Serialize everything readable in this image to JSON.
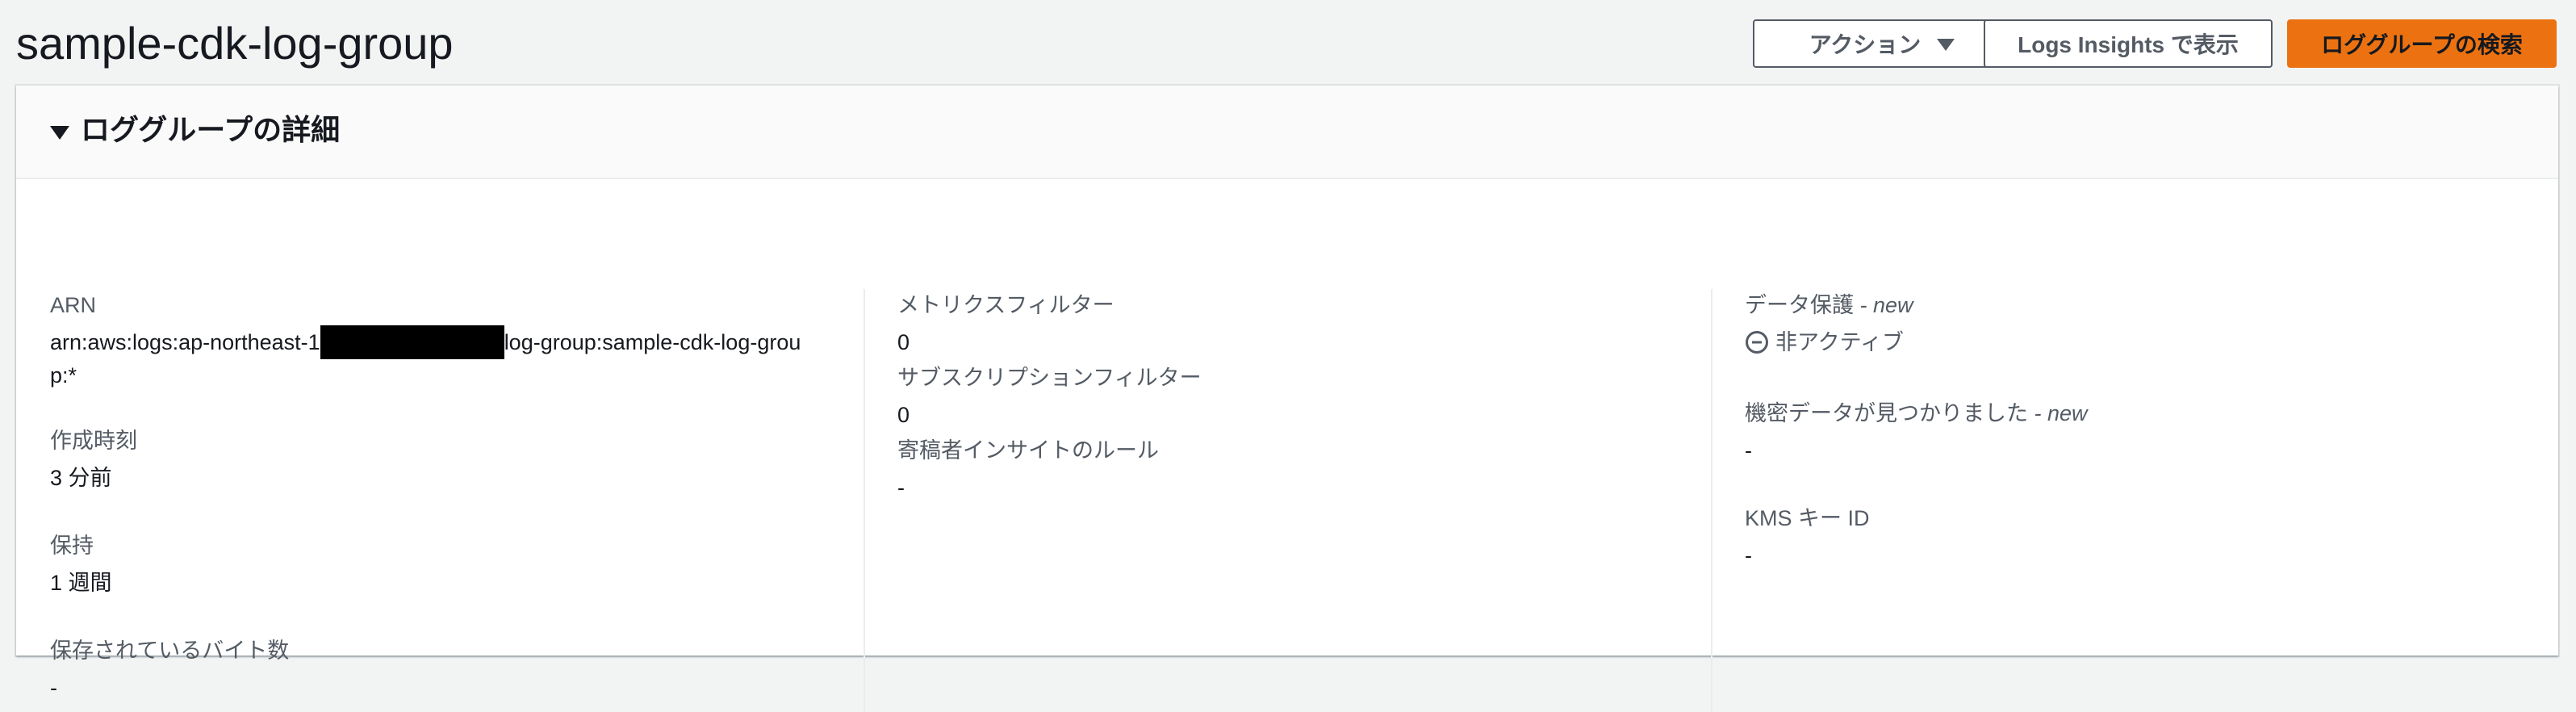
{
  "header": {
    "title": "sample-cdk-log-group",
    "actions_label": "アクション",
    "logs_insights_label": "Logs Insights で表示",
    "search_label": "ロググループの検索"
  },
  "panel": {
    "title": "ロググループの詳細",
    "col1": {
      "arn_label": "ARN",
      "arn_prefix": "arn:aws:logs:ap-northeast-1",
      "arn_suffix": "log-group:sample-cdk-log-group:*",
      "created_label": "作成時刻",
      "created_value": "3 分前",
      "retention_label": "保持",
      "retention_value": "1 週間",
      "stored_bytes_label": "保存されているバイト数",
      "stored_bytes_value": "-"
    },
    "col2": {
      "metric_filters_label": "メトリクスフィルター",
      "metric_filters_value": "0",
      "subscription_filters_label": "サブスクリプションフィルター",
      "subscription_filters_value": "0",
      "contributor_insights_label": "寄稿者インサイトのルール",
      "contributor_insights_value": "-"
    },
    "col3": {
      "data_protection_label": "データ保護",
      "data_protection_new": "- new",
      "data_protection_value": "非アクティブ",
      "sensitive_data_label": "機密データが見つかりました",
      "sensitive_data_new": "- new",
      "sensitive_data_value": "-",
      "kms_label": "KMS キー ID",
      "kms_value": "-"
    }
  },
  "colors": {
    "primary_button": "#ec7211",
    "page_background": "#f2f3f3",
    "panel_header_background": "#fafafa"
  },
  "icons": {
    "status_inactive": "circle-minus-icon",
    "actions_dropdown": "caret-down-icon",
    "panel_toggle": "triangle-down-icon"
  }
}
